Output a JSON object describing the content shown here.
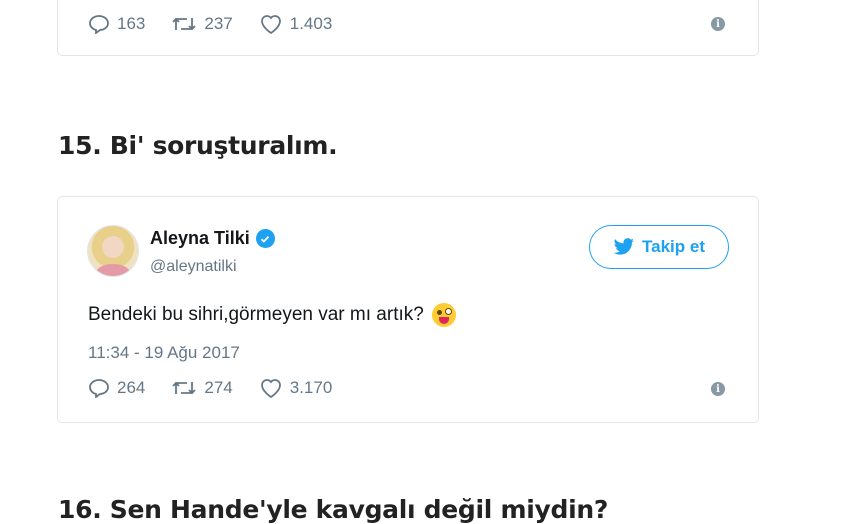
{
  "top_tweet": {
    "replies": "163",
    "retweets": "237",
    "likes": "1.403"
  },
  "section_15": {
    "heading": "15. Bi' soruşturalım."
  },
  "tweet": {
    "display_name": "Aleyna Tilki",
    "handle": "@aleynatilki",
    "follow_label": "Takip et",
    "text": "Bendeki bu sihri,görmeyen var mı artık?",
    "emoji": "winking-face-with-tongue",
    "timestamp": "11:34 - 19 Ağu 2017",
    "replies": "264",
    "retweets": "274",
    "likes": "3.170",
    "colors": {
      "accent": "#1da1f2",
      "muted": "#657786",
      "border": "#e1e8ed"
    }
  },
  "section_16": {
    "heading": "16. Sen Hande'yle kavgalı değil miydin?"
  }
}
